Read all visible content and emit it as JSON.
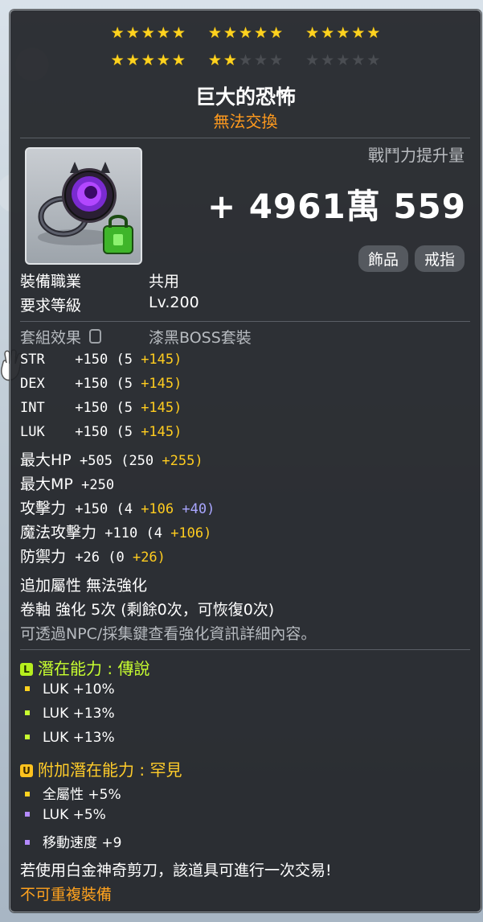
{
  "stars": {
    "row1": [
      "on",
      "on",
      "on",
      "on",
      "on",
      "on",
      "on",
      "on",
      "on",
      "on",
      "on",
      "on",
      "on",
      "on",
      "on"
    ],
    "row2": [
      "on",
      "on",
      "off",
      "off",
      "off",
      "off",
      "off",
      "off",
      "off",
      "off"
    ]
  },
  "item": {
    "name": "巨大的恐怖",
    "trade": "無法交換"
  },
  "combat_power": {
    "label": "戰鬥力提升量",
    "value": "+ 4961萬 559"
  },
  "tags": [
    "飾品",
    "戒指"
  ],
  "info": {
    "job_label": "裝備職業",
    "job_value": "共用",
    "level_label": "要求等級",
    "level_value": "Lv.200",
    "set_label": "套組效果",
    "set_value": "漆黑BOSS套裝"
  },
  "stats": [
    {
      "name": "STR",
      "total": "+150",
      "base": "(5",
      "bonus": "+145)",
      "extra": ""
    },
    {
      "name": "DEX",
      "total": "+150",
      "base": "(5",
      "bonus": "+145)",
      "extra": ""
    },
    {
      "name": "INT",
      "total": "+150",
      "base": "(5",
      "bonus": "+145)",
      "extra": ""
    },
    {
      "name": "LUK",
      "total": "+150",
      "base": "(5",
      "bonus": "+145)",
      "extra": ""
    },
    {
      "name": "最大HP",
      "total": "+505",
      "base": "(250",
      "bonus": "+255)",
      "extra": ""
    },
    {
      "name": "最大MP",
      "total": "+250",
      "base": "",
      "bonus": "",
      "extra": ""
    },
    {
      "name": "攻擊力",
      "total": "+150",
      "base": "(4",
      "bonus": "+106",
      "extra": "+40)"
    },
    {
      "name": "魔法攻擊力",
      "total": "+110",
      "base": "(4",
      "bonus": "+106)",
      "extra": ""
    },
    {
      "name": "防禦力",
      "total": "+26",
      "base": "(0",
      "bonus": "+26)",
      "extra": ""
    }
  ],
  "extra_attr": "追加屬性 無法強化",
  "scroll": "卷軸 強化 5次 (剩餘0次，可恢復0次)",
  "npc_hint": "可透過NPC/採集鍵查看強化資訊詳細內容。",
  "potential": {
    "title": "潛在能力 : 傳說",
    "badge": "L",
    "lines": [
      "LUK +10%",
      "LUK +13%",
      "LUK +13%"
    ]
  },
  "additional_potential": {
    "title": "附加潛在能力 : 罕見",
    "badge": "U",
    "lines": [
      "全屬性 +5%",
      "LUK +5%",
      "移動速度 +9"
    ]
  },
  "footer": {
    "scissors": "若使用白金神奇剪刀，該道具可進行一次交易!",
    "unique": "不可重複裝備"
  }
}
